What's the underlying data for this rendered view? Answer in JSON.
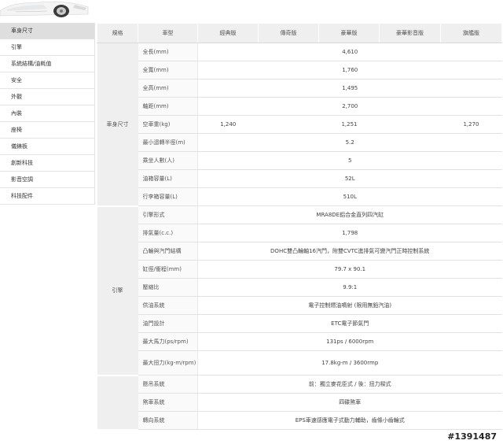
{
  "sidebar": {
    "items": [
      {
        "label": "車身尺寸",
        "active": true
      },
      {
        "label": "引擎"
      },
      {
        "label": "系統結構/油耗值"
      },
      {
        "label": "安全"
      },
      {
        "label": "外觀"
      },
      {
        "label": "內裝"
      },
      {
        "label": "座椅"
      },
      {
        "label": "儀錶板"
      },
      {
        "label": "創新科技"
      },
      {
        "label": "影音空調"
      },
      {
        "label": "科技配件"
      }
    ]
  },
  "table": {
    "headers": {
      "category": "規格",
      "model": "車型",
      "trims": [
        "經典版",
        "傳奇版",
        "豪華版",
        "豪華影音版",
        "旗艦版"
      ]
    },
    "sections": [
      {
        "name": "車身尺寸",
        "rows": [
          {
            "item": "全長(mm)",
            "value": "4,610"
          },
          {
            "item": "全寬(mm)",
            "value": "1,760"
          },
          {
            "item": "全高(mm)",
            "value": "1,495"
          },
          {
            "item": "軸距(mm)",
            "value": "2,700"
          },
          {
            "item": "空車重(kg)",
            "split": [
              "1,240",
              "1,251",
              "1,270"
            ]
          },
          {
            "item": "最小迴轉半徑(m)",
            "value": "5.2"
          },
          {
            "item": "乘坐人數(人)",
            "value": "5"
          },
          {
            "item": "油箱容量(L)",
            "value": "52L"
          },
          {
            "item": "行李箱容量(L)",
            "value": "510L"
          }
        ]
      },
      {
        "name": "引擎",
        "rows": [
          {
            "item": "引擎形式",
            "value": "MRA8DE鋁合金直列四汽缸"
          },
          {
            "item": "排氣量(c.c.)",
            "value": "1,798"
          },
          {
            "item": "凸輪與汽門結構",
            "value": "DOHC雙凸輪軸16汽門，附雙CVTC進排氣可變汽門正時控制系統"
          },
          {
            "item": "缸徑/衝程(mm)",
            "value": "79.7 x 90.1"
          },
          {
            "item": "壓縮比",
            "value": "9.9:1"
          },
          {
            "item": "供油系統",
            "value": "電子控制燃油噴射 (限用無鉛汽油)"
          },
          {
            "item": "油門設計",
            "value": "ETC電子節氣門"
          },
          {
            "item": "最大馬力(ps/rpm)",
            "value": "131ps / 6000rpm"
          },
          {
            "item": "最大扭力(kg-m/rpm)",
            "value": "17.8kg-m / 3600rmp"
          }
        ]
      },
      {
        "name": "",
        "rows": [
          {
            "item": "懸吊系統",
            "value": "前：獨立麥花臣式 / 後：扭力樑式"
          },
          {
            "item": "煞車系統",
            "value": "四碟煞車"
          },
          {
            "item": "轉向系統",
            "value": "EPS車速感應電子式動力輔助，齒條小齒輪式"
          }
        ]
      }
    ]
  },
  "watermark": "#1391487"
}
